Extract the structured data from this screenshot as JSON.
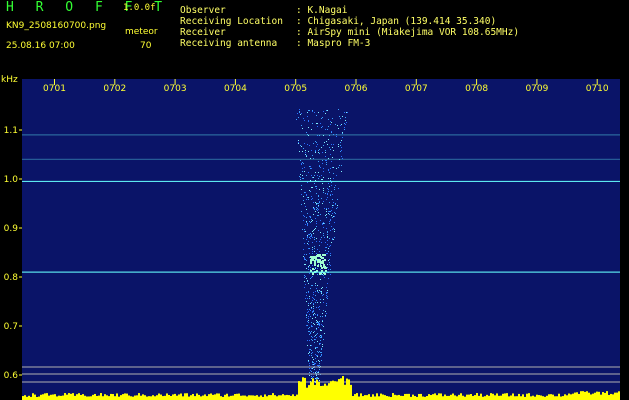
{
  "header": {
    "app_title": "H R O F F T",
    "version": "1.0.0f",
    "filename": "KN9_2508160700.png",
    "plot_type": "meteor",
    "datetime": "25.08.16 07:00",
    "count": "70"
  },
  "metadata": [
    {
      "label": "Observer",
      "value": ": K.Nagai"
    },
    {
      "label": "Receiving Location",
      "value": ": Chigasaki, Japan (139.414 35.340)"
    },
    {
      "label": "Receiver",
      "value": ": AirSpy mini (Miakejima VOR 108.65MHz)"
    },
    {
      "label": "Receiving antenna",
      "value": ": Maspro FM-3"
    }
  ],
  "axis": {
    "y_unit": "kHz",
    "y_ticks": [
      "1.1",
      "1.0",
      "0.9",
      "0.8",
      "0.7",
      "0.6"
    ],
    "x_ticks": [
      "0701",
      "0702",
      "0703",
      "0704",
      "0705",
      "0706",
      "0707",
      "0708",
      "0709",
      "0710"
    ]
  },
  "colors": {
    "background": "#000000",
    "spectrogram_base": "#0a1468",
    "label_yellow": "#ffff33",
    "title_green": "#33ff33",
    "signal_line": "#66ffff"
  }
}
